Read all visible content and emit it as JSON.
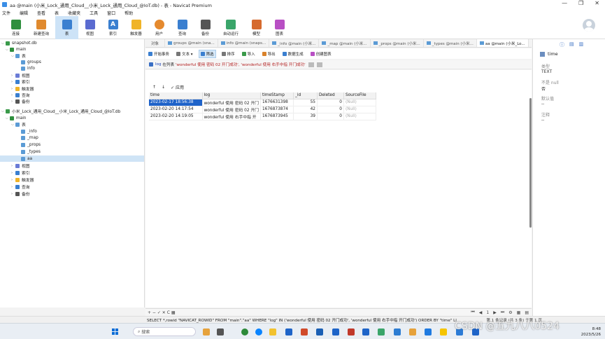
{
  "window": {
    "title": "aa @main (小米_Lock_通用_Cloud__小米_Lock_通用_Cloud_@IoT.db) - 表 - Navicat Premium",
    "controls": [
      "—",
      "❐",
      "✕"
    ]
  },
  "menu": [
    "文件",
    "编辑",
    "查看",
    "表",
    "收藏夹",
    "工具",
    "窗口",
    "帮助"
  ],
  "toolbar": [
    {
      "label": "连接",
      "icon": "connect-icon",
      "color": "#2f8f3e"
    },
    {
      "label": "新建查询",
      "icon": "new-query-icon",
      "color": "#e08a2e"
    },
    {
      "label": "表",
      "icon": "table-icon",
      "color": "#3a7fd0"
    },
    {
      "label": "视图",
      "icon": "view-icon",
      "color": "#5a6bd0"
    },
    {
      "label": "索引",
      "icon": "index-icon",
      "color": "#3a7fd0"
    },
    {
      "label": "触发器",
      "icon": "trigger-icon",
      "color": "#f0b428"
    },
    {
      "label": "用户",
      "icon": "user-icon",
      "color": "#e58a2e"
    },
    {
      "label": "查询",
      "icon": "query-icon",
      "color": "#3a7fd0"
    },
    {
      "label": "备份",
      "icon": "backup-icon",
      "color": "#555"
    },
    {
      "label": "自动运行",
      "icon": "automation-icon",
      "color": "#3aa56a"
    },
    {
      "label": "模型",
      "icon": "model-icon",
      "color": "#d66a2e"
    },
    {
      "label": "图表",
      "icon": "chart-icon",
      "color": "#b84fc4"
    }
  ],
  "sidebar": {
    "tree": [
      {
        "label": "snapshot.db",
        "level": 0,
        "icon": "db"
      },
      {
        "label": "main",
        "level": 1,
        "icon": "schema"
      },
      {
        "label": "表",
        "level": 2,
        "icon": "tablefolder"
      },
      {
        "label": "groups",
        "level": 3,
        "icon": "table"
      },
      {
        "label": "info",
        "level": 3,
        "icon": "table"
      },
      {
        "label": "视图",
        "level": 2,
        "icon": "view"
      },
      {
        "label": "索引",
        "level": 2,
        "icon": "index"
      },
      {
        "label": "触发器",
        "level": 2,
        "icon": "trigger"
      },
      {
        "label": "查询",
        "level": 2,
        "icon": "query"
      },
      {
        "label": "备份",
        "level": 2,
        "icon": "backup"
      },
      {
        "label": "小米_Lock_通用_Cloud__小米_Lock_通用_Cloud_@IoT.db",
        "level": 0,
        "icon": "db"
      },
      {
        "label": "main",
        "level": 1,
        "icon": "schema"
      },
      {
        "label": "表",
        "level": 2,
        "icon": "tablefolder"
      },
      {
        "label": "_info",
        "level": 3,
        "icon": "table"
      },
      {
        "label": "_map",
        "level": 3,
        "icon": "table"
      },
      {
        "label": "_props",
        "level": 3,
        "icon": "table"
      },
      {
        "label": "_types",
        "level": 3,
        "icon": "table"
      },
      {
        "label": "aa",
        "level": 3,
        "icon": "table",
        "selected": true
      },
      {
        "label": "视图",
        "level": 2,
        "icon": "view"
      },
      {
        "label": "索引",
        "level": 2,
        "icon": "index"
      },
      {
        "label": "触发器",
        "level": 2,
        "icon": "trigger"
      },
      {
        "label": "查询",
        "level": 2,
        "icon": "query"
      },
      {
        "label": "备份",
        "level": 2,
        "icon": "backup"
      }
    ]
  },
  "tabs": [
    {
      "label": "对象"
    },
    {
      "label": "groups @main (sna..."
    },
    {
      "label": "info @main (snaps..."
    },
    {
      "label": "_info @main (小米..."
    },
    {
      "label": "_map @main (小米..."
    },
    {
      "label": "_props @main (小米..."
    },
    {
      "label": "_types @main (小米..."
    },
    {
      "label": "aa @main (小米_Lo...",
      "active": true
    }
  ],
  "subtoolbar": [
    {
      "label": "开始事务",
      "color": "#3a7fd0"
    },
    {
      "label": "文本 ▾",
      "color": "#777"
    },
    {
      "label": "筛选",
      "color": "#3a7fd0",
      "active": true
    },
    {
      "label": "排序",
      "color": "#777"
    },
    {
      "label": "导入",
      "color": "#3a9a4a"
    },
    {
      "label": "导出",
      "color": "#d9822b"
    },
    {
      "label": "数据生成",
      "color": "#3a7fd0"
    },
    {
      "label": "创建图表",
      "color": "#b84fc4"
    }
  ],
  "filter": {
    "field": "log",
    "op": "在列表",
    "values": "'wonderful 使用 密码 02 开门成功', 'wonderful 使用 右手中指 开门成功'"
  },
  "sort_actions": [
    "↑",
    "↓",
    "✓ 应用"
  ],
  "table": {
    "columns": [
      "time",
      "log",
      "timeStamp",
      "_id",
      "Deleted",
      "SourceFile"
    ],
    "rows": [
      [
        "2023-02-17 18:56:38",
        "wonderful 使用 密码 02 开门",
        "1676631398",
        "55",
        "0",
        "(Null)"
      ],
      [
        "2023-02-20 14:17:54",
        "wonderful 使用 密码 02 开门",
        "1676873874",
        "42",
        "0",
        "(Null)"
      ],
      [
        "2023-02-20 14:19:05",
        "wonderful 使用 右手中指 开",
        "1676873945",
        "39",
        "0",
        "(Null)"
      ]
    ]
  },
  "bottom_nav": {
    "left": "+ − ✓ ✕ C ▦",
    "page": "1"
  },
  "info_panel": {
    "field": "time",
    "type_label": "类型",
    "type_value": "TEXT",
    "notnull_label": "不是 null",
    "notnull_value": "否",
    "default_label": "默认值",
    "default_value": "--",
    "comment_label": "注释",
    "comment_value": "--"
  },
  "status": {
    "sql": "SELECT *,rowid \"NAVICAT_ROWID\" FROM \"main\".\"aa\" WHERE \"log\" IN ('wonderful 使用 密码 02 开门成功', 'wonderful 使用 右手中指 开门成功') ORDER BY \"time\" LI",
    "record": "第 1 条记录 (共 3 条) 于第 1 页"
  },
  "taskbar": {
    "search_placeholder": "搜索",
    "time": "8:48",
    "date": "2023/5/26"
  },
  "watermark": "CSDN @五九八八0524"
}
